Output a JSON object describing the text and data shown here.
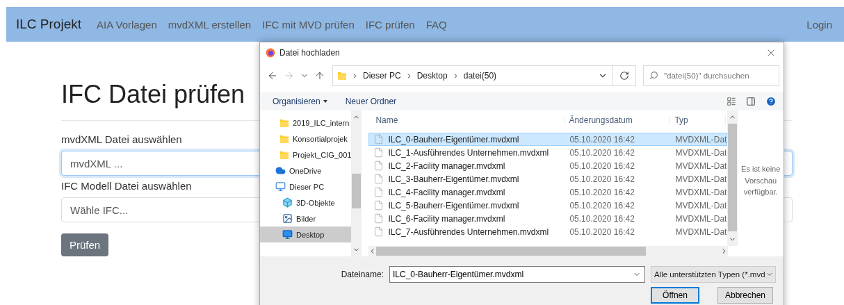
{
  "navbar": {
    "brand": "ILC Projekt",
    "links": [
      "AIA Vorlagen",
      "mvdXML erstellen",
      "IFC mit MVD prüfen",
      "IFC prüfen",
      "FAQ"
    ],
    "login": "Login"
  },
  "page": {
    "heading": "IFC Datei prüfen",
    "fields": [
      {
        "label": "mvdXML Datei auswählen",
        "placeholder": "mvdXML ...",
        "focused": true
      },
      {
        "label": "IFC Modell Datei auswählen",
        "placeholder": "Wähle IFC...",
        "focused": false
      }
    ],
    "submit": "Prüfen"
  },
  "dialog": {
    "title": "Datei hochladen",
    "path": [
      "Dieser PC",
      "Desktop",
      "datei(50)"
    ],
    "search": {
      "placeholder": "\"datei(50)\" durchsuchen"
    },
    "toolbar": {
      "organize": "Organisieren",
      "new_folder": "Neuer Ordner"
    },
    "nav_items": [
      {
        "label": "2019_ILC_intern",
        "kind": "folder",
        "selected": false
      },
      {
        "label": "Konsortialprojek",
        "kind": "folder",
        "selected": false
      },
      {
        "label": "Projekt_CIG_001",
        "kind": "folder",
        "selected": false
      },
      {
        "label": "OneDrive",
        "kind": "cloud",
        "selected": false
      },
      {
        "label": "Dieser PC",
        "kind": "pc",
        "selected": false,
        "children": [
          {
            "label": "3D-Objekte",
            "kind": "cube",
            "selected": false
          },
          {
            "label": "Bilder",
            "kind": "pictures",
            "selected": false
          },
          {
            "label": "Desktop",
            "kind": "desktop",
            "selected": true
          }
        ]
      }
    ],
    "columns": [
      "Name",
      "Änderungsdatum",
      "Typ"
    ],
    "files": [
      {
        "name": "ILC_0-Bauherr-Eigentümer.mvdxml",
        "date": "05.10.2020 16:42",
        "type": "MVDXML-Dat",
        "selected": true
      },
      {
        "name": "ILC_1-Ausführendes Unternehmen.mvdxml",
        "date": "05.10.2020 16:42",
        "type": "MVDXML-Dat",
        "selected": false
      },
      {
        "name": "ILC_2-Facility manager.mvdxml",
        "date": "05.10.2020 16:42",
        "type": "MVDXML-Dat",
        "selected": false
      },
      {
        "name": "ILC_3-Bauherr-Eigentümer.mvdxml",
        "date": "05.10.2020 16:42",
        "type": "MVDXML-Dat",
        "selected": false
      },
      {
        "name": "ILC_4-Facility manager.mvdxml",
        "date": "05.10.2020 16:42",
        "type": "MVDXML-Dat",
        "selected": false
      },
      {
        "name": "ILC_5-Bauherr-Eigentümer.mvdxml",
        "date": "05.10.2020 16:42",
        "type": "MVDXML-Dat",
        "selected": false
      },
      {
        "name": "ILC_6-Facility manager.mvdxml",
        "date": "05.10.2020 16:42",
        "type": "MVDXML-Dat",
        "selected": false
      },
      {
        "name": "ILC_7-Ausführendes Unternehmen.mvdxml",
        "date": "05.10.2020 16:42",
        "type": "MVDXML-Dat",
        "selected": false
      }
    ],
    "preview": "Es ist keine Vorschau verfügbar.",
    "filename": {
      "label": "Dateiname:",
      "value": "ILC_0-Bauherr-Eigentümer.mvdxml"
    },
    "filetype": "Alle unterstützten Typen (*.mvd",
    "buttons": [
      {
        "label": "Öffnen",
        "default": true
      },
      {
        "label": "Abbrechen",
        "default": false
      }
    ]
  }
}
